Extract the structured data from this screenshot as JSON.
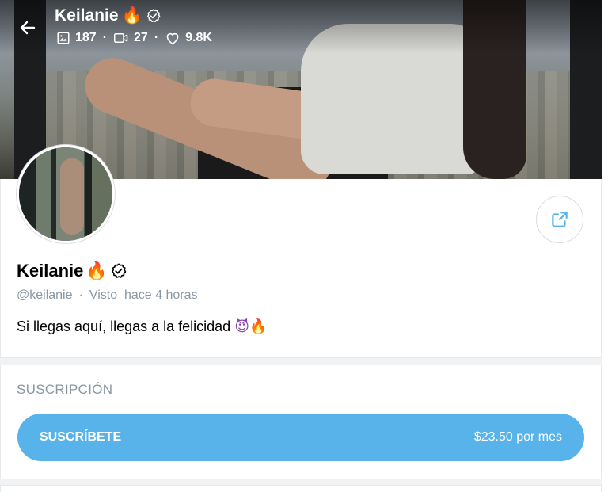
{
  "header": {
    "name": "Keilanie",
    "name_emoji": "🔥",
    "stats": {
      "photos": "187",
      "videos": "27",
      "likes": "9.8K"
    }
  },
  "icons": {
    "back": "arrow-left-icon",
    "verified": "verified-badge-icon",
    "photos": "image-icon",
    "videos": "video-icon",
    "likes": "heart-icon",
    "share": "share-icon"
  },
  "profile": {
    "name": "Keilanie",
    "name_emoji": "🔥",
    "handle": "@keilanie",
    "separator": "·",
    "last_seen": "Visto  hace 4 horas",
    "bio": "Si llegas aquí, llegas a la felicidad",
    "bio_emoji_devil": "😈",
    "bio_emoji_fire": "🔥"
  },
  "subscription": {
    "heading": "SUSCRIPCIÓN",
    "button_label": "SUSCRÍBETE",
    "price": "$23.50 por mes"
  },
  "colors": {
    "accent": "#58b3ea",
    "muted_text": "#8a96a3",
    "divider": "#f0f2f4"
  }
}
